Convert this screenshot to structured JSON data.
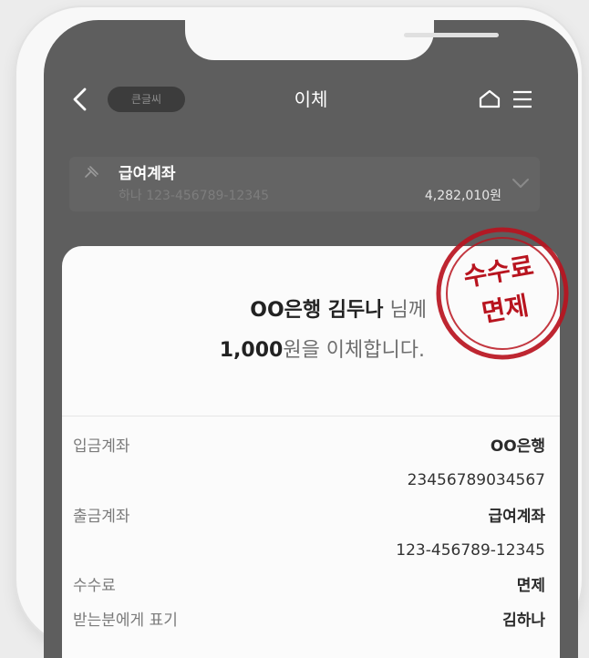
{
  "header": {
    "badge": "큰글씨",
    "title": "이체"
  },
  "account": {
    "name": "급여계좌",
    "number": "하나 123-456789-12345",
    "balance": "4,282,010원"
  },
  "confirm": {
    "bank_recipient": "OO은행 김두나",
    "honorific": "님께",
    "amount": "1,000",
    "amount_suffix": "원을 이체합니다."
  },
  "details": [
    {
      "label": "입금계좌",
      "value": "OO은행"
    },
    {
      "label": "",
      "value": "23456789034567"
    },
    {
      "label": "출금계좌",
      "value": "급여계좌"
    },
    {
      "label": "",
      "value": "123-456789-12345"
    },
    {
      "label": "수수료",
      "value": "면제"
    },
    {
      "label": "받는분에게 표기",
      "value": "김하나"
    }
  ],
  "stamp": {
    "line1": "수수료",
    "line2": "면제",
    "color": "#b8141f"
  },
  "icons": {
    "back": "back-arrow-icon",
    "home": "home-icon",
    "menu": "hamburger-menu-icon",
    "pin": "pin-icon",
    "expand": "chevron-down-icon"
  }
}
